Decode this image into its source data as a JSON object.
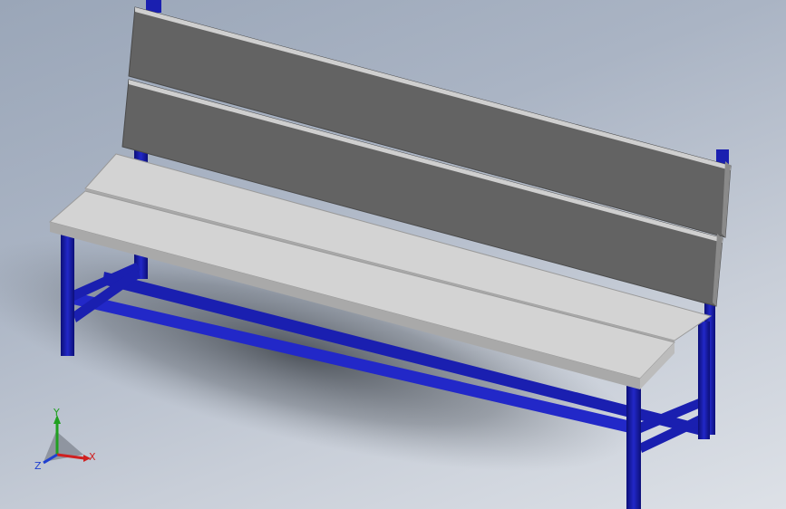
{
  "viewport": {
    "background_top": "#9aa6b8",
    "background_bottom": "#dde1e7"
  },
  "model": {
    "frame_color": "#1a1fb0",
    "frame_color_dark": "#0c0f78",
    "seat_slat_color": "#d3d3d3",
    "seat_slat_edge": "#a9a9a9",
    "back_slat_color": "#636363",
    "back_slat_edge": "#b8b8b8"
  },
  "triad": {
    "x_label": "X",
    "y_label": "Y",
    "z_label": "Z",
    "x_color": "#d02020",
    "y_color": "#20a020",
    "z_color": "#2040d0"
  }
}
